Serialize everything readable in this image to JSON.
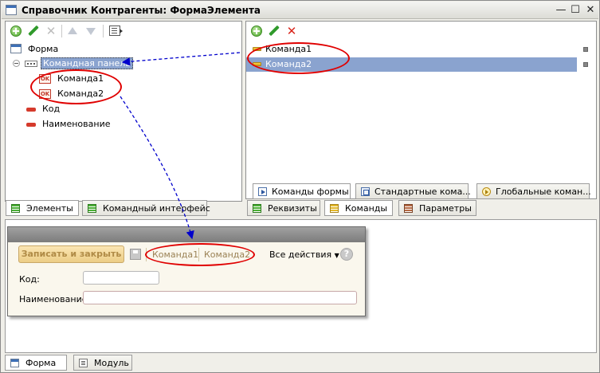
{
  "window": {
    "title": "Справочник Контрагенты: ФормаЭлемента"
  },
  "tree": {
    "items": [
      {
        "label": "Форма"
      },
      {
        "label": "Командная панель"
      },
      {
        "label": "Команда1"
      },
      {
        "label": "Команда2"
      },
      {
        "label": "Код"
      },
      {
        "label": "Наименование"
      }
    ]
  },
  "left_tabs": [
    {
      "label": "Элементы"
    },
    {
      "label": "Командный интерфейс"
    }
  ],
  "commands": {
    "items": [
      {
        "label": "Команда1"
      },
      {
        "label": "Команда2"
      }
    ],
    "inner_tabs": [
      {
        "label": "Команды формы"
      },
      {
        "label": "Стандартные кома..."
      },
      {
        "label": "Глобальные коман..."
      }
    ]
  },
  "right_tabs": [
    {
      "label": "Реквизиты"
    },
    {
      "label": "Команды"
    },
    {
      "label": "Параметры"
    }
  ],
  "preview": {
    "save_close": "Записать и закрыть",
    "cmd1": "Команда1",
    "cmd2": "Команда2",
    "all_actions": "Все действия",
    "help": "?",
    "code_label": "Код:",
    "name_label": "Наименование:",
    "code_value": "",
    "name_value": ""
  },
  "bottom_tabs": [
    {
      "label": "Форма"
    },
    {
      "label": "Модуль"
    }
  ],
  "colors": {
    "annotation_oval": "#e00000",
    "arrow": "#0000cc",
    "selection": "#8aa3cf"
  }
}
